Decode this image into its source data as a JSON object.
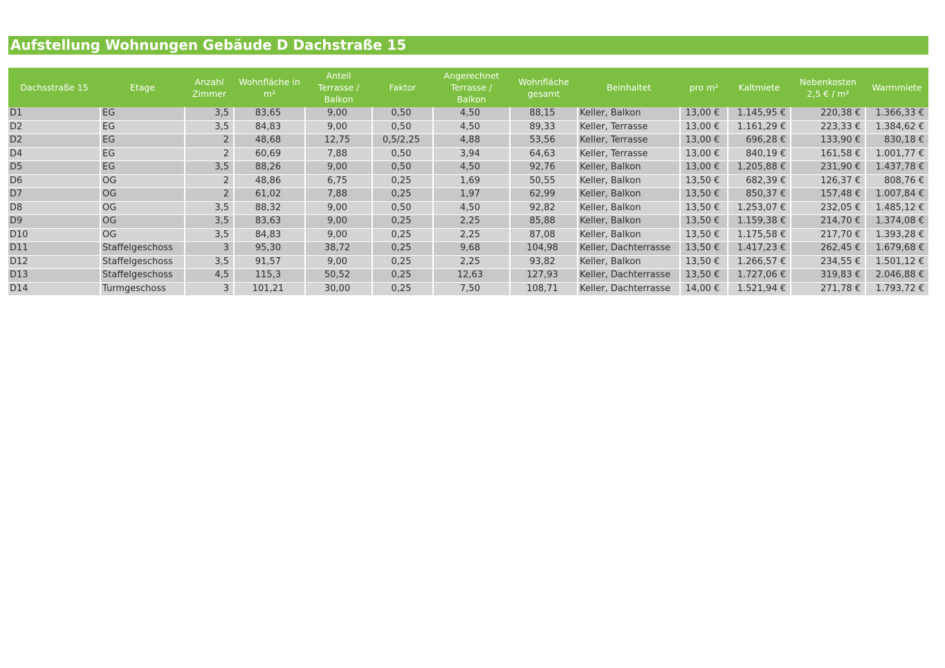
{
  "title": "Aufstellung Wohnungen Gebäude D Dachstraße 15",
  "columns": [
    "Dachsstraße 15",
    "Etage",
    "Anzahl\nZimmer",
    "Wohnfläche in\nm²",
    "Anteil\nTerrasse /\nBalkon",
    "Faktor",
    "Angerechnet\nTerrasse /\nBalkon",
    "Wohnfläche\ngesamt",
    "Beinhaltet",
    "pro m²",
    "Kaltmiete",
    "Nebenkosten\n2,5 € / m²",
    "Warmmiete"
  ],
  "rows": [
    [
      "D1",
      "EG",
      "3,5",
      "83,65",
      "9,00",
      "0,50",
      "4,50",
      "88,15",
      "Keller, Balkon",
      "13,00 €",
      "1.145,95 €",
      "220,38 €",
      "1.366,33 €"
    ],
    [
      "D2",
      "EG",
      "3,5",
      "84,83",
      "9,00",
      "0,50",
      "4,50",
      "89,33",
      "Keller, Terrasse",
      "13,00 €",
      "1.161,29 €",
      "223,33 €",
      "1.384,62 €"
    ],
    [
      "D2",
      "EG",
      "2",
      "48,68",
      "12,75",
      "0,5/2,25",
      "4,88",
      "53,56",
      "Keller, Terrasse",
      "13,00 €",
      "696,28 €",
      "133,90 €",
      "830,18 €"
    ],
    [
      "D4",
      "EG",
      "2",
      "60,69",
      "7,88",
      "0,50",
      "3,94",
      "64,63",
      "Keller, Terrasse",
      "13,00 €",
      "840,19 €",
      "161,58 €",
      "1.001,77 €"
    ],
    [
      "D5",
      "EG",
      "3,5",
      "88,26",
      "9,00",
      "0,50",
      "4,50",
      "92,76",
      "Keller, Balkon",
      "13,00 €",
      "1.205,88 €",
      "231,90 €",
      "1.437,78 €"
    ],
    [
      "D6",
      "OG",
      "2",
      "48,86",
      "6,75",
      "0,25",
      "1,69",
      "50,55",
      "Keller, Balkon",
      "13,50 €",
      "682,39 €",
      "126,37 €",
      "808,76 €"
    ],
    [
      "D7",
      "OG",
      "2",
      "61,02",
      "7,88",
      "0,25",
      "1,97",
      "62,99",
      "Keller, Balkon",
      "13,50 €",
      "850,37 €",
      "157,48 €",
      "1.007,84 €"
    ],
    [
      "D8",
      "OG",
      "3,5",
      "88,32",
      "9,00",
      "0,50",
      "4,50",
      "92,82",
      "Keller, Balkon",
      "13,50 €",
      "1.253,07 €",
      "232,05 €",
      "1.485,12 €"
    ],
    [
      "D9",
      "OG",
      "3,5",
      "83,63",
      "9,00",
      "0,25",
      "2,25",
      "85,88",
      "Keller, Balkon",
      "13,50 €",
      "1.159,38 €",
      "214,70 €",
      "1.374,08 €"
    ],
    [
      "D10",
      "OG",
      "3,5",
      "84,83",
      "9,00",
      "0,25",
      "2,25",
      "87,08",
      "Keller, Balkon",
      "13,50 €",
      "1.175,58 €",
      "217,70 €",
      "1.393,28 €"
    ],
    [
      "D11",
      "Staffelgeschoss",
      "3",
      "95,30",
      "38,72",
      "0,25",
      "9,68",
      "104,98",
      "Keller, Dachterrasse",
      "13,50 €",
      "1.417,23 €",
      "262,45 €",
      "1.679,68 €"
    ],
    [
      "D12",
      "Staffelgeschoss",
      "3,5",
      "91,57",
      "9,00",
      "0,25",
      "2,25",
      "93,82",
      "Keller, Balkon",
      "13,50 €",
      "1.266,57 €",
      "234,55 €",
      "1.501,12 €"
    ],
    [
      "D13",
      "Staffelgeschoss",
      "4,5",
      "115,3",
      "50,52",
      "0,25",
      "12,63",
      "127,93",
      "Keller, Dachterrasse",
      "13,50 €",
      "1.727,06 €",
      "319,83 €",
      "2.046,88 €"
    ],
    [
      "D14",
      "Turmgeschoss",
      "3",
      "101,21",
      "30,00",
      "0,25",
      "7,50",
      "108,71",
      "Keller, Dachterrasse",
      "14,00 €",
      "1.521,94 €",
      "271,78 €",
      "1.793,72 €"
    ]
  ]
}
